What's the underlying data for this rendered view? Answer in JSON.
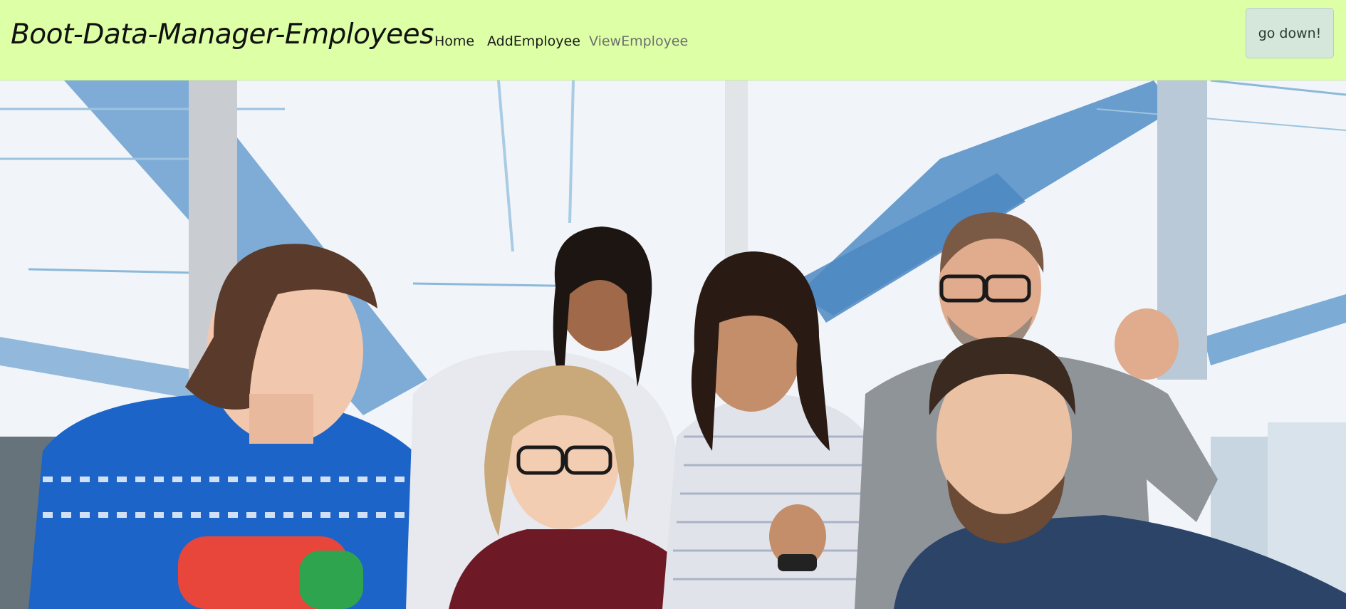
{
  "navbar": {
    "brand": "Boot-Data-Manager-Employees",
    "links": [
      {
        "label": "Home"
      },
      {
        "label": "AddEmployee"
      },
      {
        "label": "ViewEmployee"
      }
    ],
    "go_down_label": "go down!"
  },
  "hero": {
    "image_description_icon": "group-photo"
  }
}
